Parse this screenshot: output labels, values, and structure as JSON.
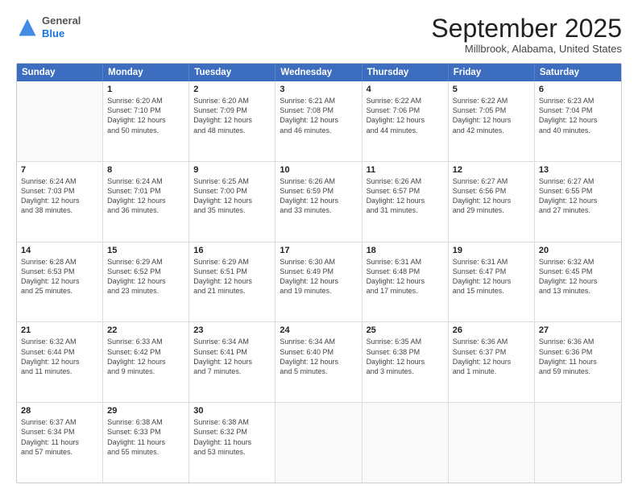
{
  "header": {
    "logo_line1": "General",
    "logo_line2": "Blue",
    "month_title": "September 2025",
    "location": "Millbrook, Alabama, United States"
  },
  "calendar": {
    "days_of_week": [
      "Sunday",
      "Monday",
      "Tuesday",
      "Wednesday",
      "Thursday",
      "Friday",
      "Saturday"
    ],
    "weeks": [
      [
        {
          "day": "",
          "info": ""
        },
        {
          "day": "1",
          "info": "Sunrise: 6:20 AM\nSunset: 7:10 PM\nDaylight: 12 hours\nand 50 minutes."
        },
        {
          "day": "2",
          "info": "Sunrise: 6:20 AM\nSunset: 7:09 PM\nDaylight: 12 hours\nand 48 minutes."
        },
        {
          "day": "3",
          "info": "Sunrise: 6:21 AM\nSunset: 7:08 PM\nDaylight: 12 hours\nand 46 minutes."
        },
        {
          "day": "4",
          "info": "Sunrise: 6:22 AM\nSunset: 7:06 PM\nDaylight: 12 hours\nand 44 minutes."
        },
        {
          "day": "5",
          "info": "Sunrise: 6:22 AM\nSunset: 7:05 PM\nDaylight: 12 hours\nand 42 minutes."
        },
        {
          "day": "6",
          "info": "Sunrise: 6:23 AM\nSunset: 7:04 PM\nDaylight: 12 hours\nand 40 minutes."
        }
      ],
      [
        {
          "day": "7",
          "info": "Sunrise: 6:24 AM\nSunset: 7:03 PM\nDaylight: 12 hours\nand 38 minutes."
        },
        {
          "day": "8",
          "info": "Sunrise: 6:24 AM\nSunset: 7:01 PM\nDaylight: 12 hours\nand 36 minutes."
        },
        {
          "day": "9",
          "info": "Sunrise: 6:25 AM\nSunset: 7:00 PM\nDaylight: 12 hours\nand 35 minutes."
        },
        {
          "day": "10",
          "info": "Sunrise: 6:26 AM\nSunset: 6:59 PM\nDaylight: 12 hours\nand 33 minutes."
        },
        {
          "day": "11",
          "info": "Sunrise: 6:26 AM\nSunset: 6:57 PM\nDaylight: 12 hours\nand 31 minutes."
        },
        {
          "day": "12",
          "info": "Sunrise: 6:27 AM\nSunset: 6:56 PM\nDaylight: 12 hours\nand 29 minutes."
        },
        {
          "day": "13",
          "info": "Sunrise: 6:27 AM\nSunset: 6:55 PM\nDaylight: 12 hours\nand 27 minutes."
        }
      ],
      [
        {
          "day": "14",
          "info": "Sunrise: 6:28 AM\nSunset: 6:53 PM\nDaylight: 12 hours\nand 25 minutes."
        },
        {
          "day": "15",
          "info": "Sunrise: 6:29 AM\nSunset: 6:52 PM\nDaylight: 12 hours\nand 23 minutes."
        },
        {
          "day": "16",
          "info": "Sunrise: 6:29 AM\nSunset: 6:51 PM\nDaylight: 12 hours\nand 21 minutes."
        },
        {
          "day": "17",
          "info": "Sunrise: 6:30 AM\nSunset: 6:49 PM\nDaylight: 12 hours\nand 19 minutes."
        },
        {
          "day": "18",
          "info": "Sunrise: 6:31 AM\nSunset: 6:48 PM\nDaylight: 12 hours\nand 17 minutes."
        },
        {
          "day": "19",
          "info": "Sunrise: 6:31 AM\nSunset: 6:47 PM\nDaylight: 12 hours\nand 15 minutes."
        },
        {
          "day": "20",
          "info": "Sunrise: 6:32 AM\nSunset: 6:45 PM\nDaylight: 12 hours\nand 13 minutes."
        }
      ],
      [
        {
          "day": "21",
          "info": "Sunrise: 6:32 AM\nSunset: 6:44 PM\nDaylight: 12 hours\nand 11 minutes."
        },
        {
          "day": "22",
          "info": "Sunrise: 6:33 AM\nSunset: 6:42 PM\nDaylight: 12 hours\nand 9 minutes."
        },
        {
          "day": "23",
          "info": "Sunrise: 6:34 AM\nSunset: 6:41 PM\nDaylight: 12 hours\nand 7 minutes."
        },
        {
          "day": "24",
          "info": "Sunrise: 6:34 AM\nSunset: 6:40 PM\nDaylight: 12 hours\nand 5 minutes."
        },
        {
          "day": "25",
          "info": "Sunrise: 6:35 AM\nSunset: 6:38 PM\nDaylight: 12 hours\nand 3 minutes."
        },
        {
          "day": "26",
          "info": "Sunrise: 6:36 AM\nSunset: 6:37 PM\nDaylight: 12 hours\nand 1 minute."
        },
        {
          "day": "27",
          "info": "Sunrise: 6:36 AM\nSunset: 6:36 PM\nDaylight: 11 hours\nand 59 minutes."
        }
      ],
      [
        {
          "day": "28",
          "info": "Sunrise: 6:37 AM\nSunset: 6:34 PM\nDaylight: 11 hours\nand 57 minutes."
        },
        {
          "day": "29",
          "info": "Sunrise: 6:38 AM\nSunset: 6:33 PM\nDaylight: 11 hours\nand 55 minutes."
        },
        {
          "day": "30",
          "info": "Sunrise: 6:38 AM\nSunset: 6:32 PM\nDaylight: 11 hours\nand 53 minutes."
        },
        {
          "day": "",
          "info": ""
        },
        {
          "day": "",
          "info": ""
        },
        {
          "day": "",
          "info": ""
        },
        {
          "day": "",
          "info": ""
        }
      ]
    ]
  }
}
